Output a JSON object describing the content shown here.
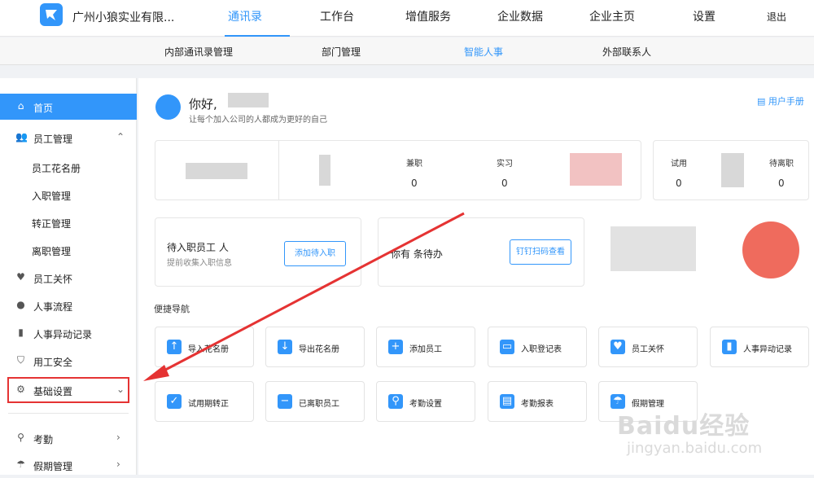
{
  "top_nav": {
    "company_name": "广州小狼实业有限...",
    "tabs": [
      "通讯录",
      "工作台",
      "增值服务",
      "企业数据",
      "企业主页",
      "设置"
    ],
    "active_tab": "通讯录",
    "logout": "退出"
  },
  "sub_nav": {
    "tabs": [
      "内部通讯录管理",
      "部门管理",
      "智能人事",
      "外部联系人"
    ],
    "active_tab": "智能人事"
  },
  "sidebar": {
    "home": "首页",
    "employee_mgmt": "员工管理",
    "employee_sub": [
      "员工花名册",
      "入职管理",
      "转正管理",
      "离职管理"
    ],
    "items": [
      "员工关怀",
      "人事流程",
      "人事异动记录",
      "用工安全",
      "基础设置"
    ],
    "bottom": [
      "考勤",
      "假期管理"
    ]
  },
  "header": {
    "greeting": "你好,",
    "tagline": "让每个加入公司的人都成为更好的自己",
    "manual": "用户手册"
  },
  "stats": {
    "card1": {
      "labels": [
        "兼职",
        "实习"
      ],
      "values": [
        "0",
        "0"
      ]
    },
    "card2": {
      "labels": [
        "试用",
        "待离职"
      ],
      "values": [
        "0",
        "0"
      ]
    }
  },
  "tasks": {
    "pending_hire": {
      "title": "待入职员工 人",
      "subtitle": "提前收集入职信息",
      "button": "添加待入职"
    },
    "todo": {
      "title": "你有 条待办",
      "button": "钉钉扫码查看"
    }
  },
  "quick_nav": {
    "title": "便捷导航",
    "items": [
      "导入花名册",
      "导出花名册",
      "添加员工",
      "入职登记表",
      "员工关怀",
      "人事异动记录",
      "试用期转正",
      "已离职员工",
      "考勤设置",
      "考勤报表",
      "假期管理"
    ]
  },
  "watermark": {
    "brand": "Baidu经验",
    "url": "jingyan.baidu.com"
  },
  "colors": {
    "accent": "#3296fa",
    "highlight": "#e53333"
  }
}
